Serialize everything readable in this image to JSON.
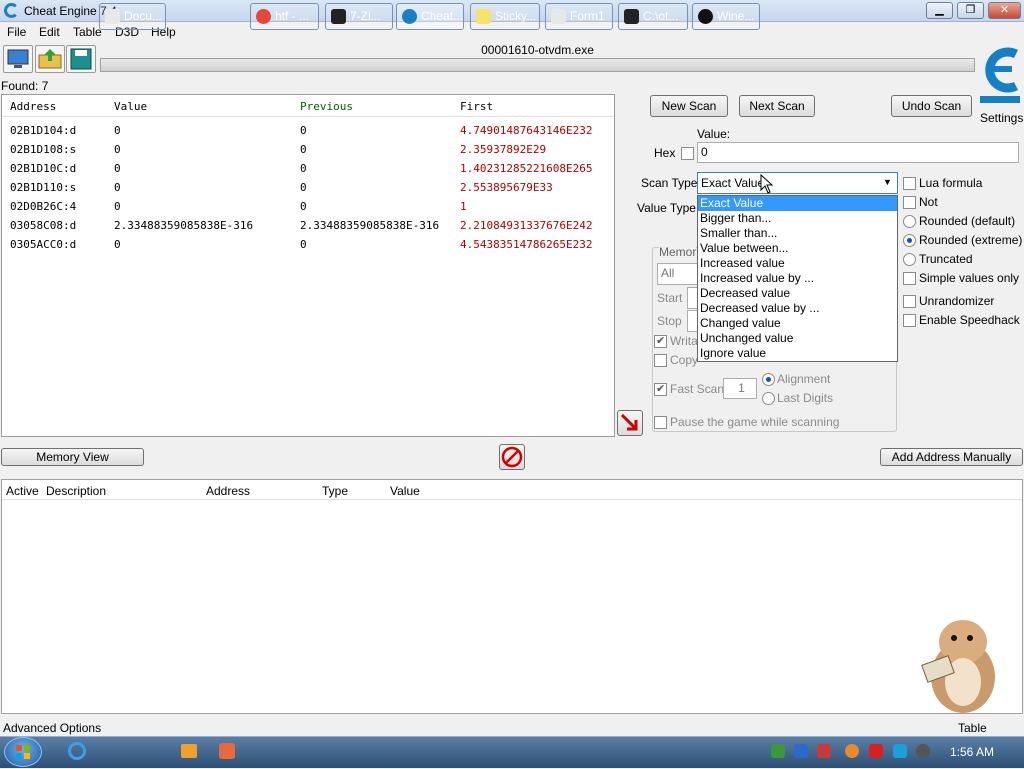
{
  "window": {
    "title": "Cheat Engine 7.4"
  },
  "menu": [
    "File",
    "Edit",
    "Table",
    "D3D",
    "Help"
  ],
  "process": {
    "name": "00001610-otvdm.exe"
  },
  "found": "Found: 7",
  "results": {
    "columns": [
      "Address",
      "Value",
      "Previous",
      "First"
    ],
    "rows": [
      {
        "address": "02B1D104:d",
        "value": "0",
        "previous": "0",
        "first": "4.74901487643146E232"
      },
      {
        "address": "02B1D108:s",
        "value": "0",
        "previous": "0",
        "first": "2.35937892E29"
      },
      {
        "address": "02B1D10C:d",
        "value": "0",
        "previous": "0",
        "first": "1.40231285221608E265"
      },
      {
        "address": "02B1D110:s",
        "value": "0",
        "previous": "0",
        "first": "2.553895679E33"
      },
      {
        "address": "02D0B26C:4",
        "value": "0",
        "previous": "0",
        "first": "1"
      },
      {
        "address": "03058C08:d",
        "value": "2.33488359085838E-316",
        "previous": "2.33488359085838E-316",
        "first": "2.21084931337676E242"
      },
      {
        "address": "0305ACC0:d",
        "value": "0",
        "previous": "0",
        "first": "4.54383514786265E232"
      }
    ]
  },
  "scan": {
    "new_scan": "New Scan",
    "next_scan": "Next Scan",
    "undo_scan": "Undo Scan",
    "settings": "Settings",
    "value_label": "Value:",
    "hex_label": "Hex",
    "value": "0",
    "scan_type_label": "Scan Type",
    "scan_type_selected": "Exact Value",
    "value_type_label": "Value Type",
    "scan_type_options": [
      "Exact Value",
      "Bigger than...",
      "Smaller than...",
      "Value between...",
      "Increased value",
      "Increased value by ...",
      "Decreased value",
      "Decreased value by ...",
      "Changed value",
      "Unchanged value",
      "Ignore value"
    ],
    "memory_label": "Memor",
    "memory_region": "All",
    "start_label": "Start",
    "stop_label": "Stop",
    "writable_label": "Writa",
    "copy_on_write_label": "Copy",
    "fast_scan_label": "Fast Scan",
    "fast_scan_value": "1",
    "alignment_label": "Alignment",
    "last_digits_label": "Last Digits",
    "pause_label": "Pause the game while scanning"
  },
  "options": {
    "lua_formula": "Lua formula",
    "not": "Not",
    "rounded_default": "Rounded (default)",
    "rounded_extreme": "Rounded (extreme)",
    "truncated": "Truncated",
    "simple_values": "Simple values only",
    "unrandomizer": "Unrandomizer",
    "speedhack": "Enable Speedhack"
  },
  "bottom": {
    "memory_view": "Memory View",
    "add_address": "Add Address Manually",
    "advanced_options": "Advanced Options",
    "table_extras": "Table Extras"
  },
  "address_list": {
    "columns": [
      "Active",
      "Description",
      "Address",
      "Type",
      "Value"
    ]
  },
  "taskbar": {
    "tasks": [
      "Docu...",
      "htf - ...",
      "7-Zi...",
      "Cheat...",
      "Sticky...",
      "Form1",
      "C:\\ot...",
      "Wine..."
    ],
    "clock": "1:56 AM"
  }
}
